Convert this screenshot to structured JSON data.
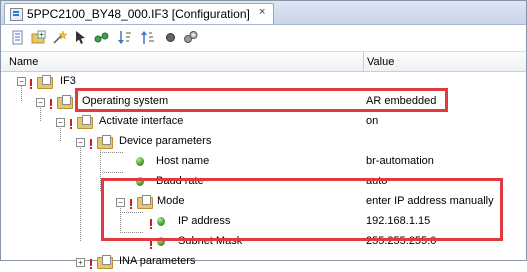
{
  "tab": {
    "title": "5PPC2100_BY48_000.IF3 [Configuration]",
    "close": "×"
  },
  "toolbar": {
    "buttons": [
      "properties-icon",
      "add-icon",
      "wizard-icon",
      "cursor-icon",
      "connect-icon",
      "sort-desc-icon",
      "sort-asc-icon",
      "record-icon",
      "settings-icon"
    ]
  },
  "columns": {
    "name": "Name",
    "value": "Value"
  },
  "tree": [
    {
      "name": "IF3",
      "value": "",
      "icon": "folder"
    },
    {
      "name": "Operating system",
      "value": "AR embedded",
      "icon": "folder"
    },
    {
      "name": "Activate interface",
      "value": "on",
      "icon": "folder"
    },
    {
      "name": "Device parameters",
      "value": "",
      "icon": "folder"
    },
    {
      "name": "Host name",
      "value": "br-automation",
      "icon": "bullet"
    },
    {
      "name": "Baud rate",
      "value": "auto",
      "icon": "bullet"
    },
    {
      "name": "Mode",
      "value": "enter IP address manually",
      "icon": "folder"
    },
    {
      "name": "IP address",
      "value": "192.168.1.15",
      "icon": "bullet"
    },
    {
      "name": "Subnet Mask",
      "value": "255.255.255.0",
      "icon": "bullet"
    },
    {
      "name": "INA parameters",
      "value": "",
      "icon": "folder"
    }
  ],
  "colors": {
    "highlight": "#e0393e",
    "tab_bar": "#c9d6ea",
    "folder": "#e6c86a",
    "bullet": "#4b9a2c",
    "warning": "#d21b1b"
  }
}
